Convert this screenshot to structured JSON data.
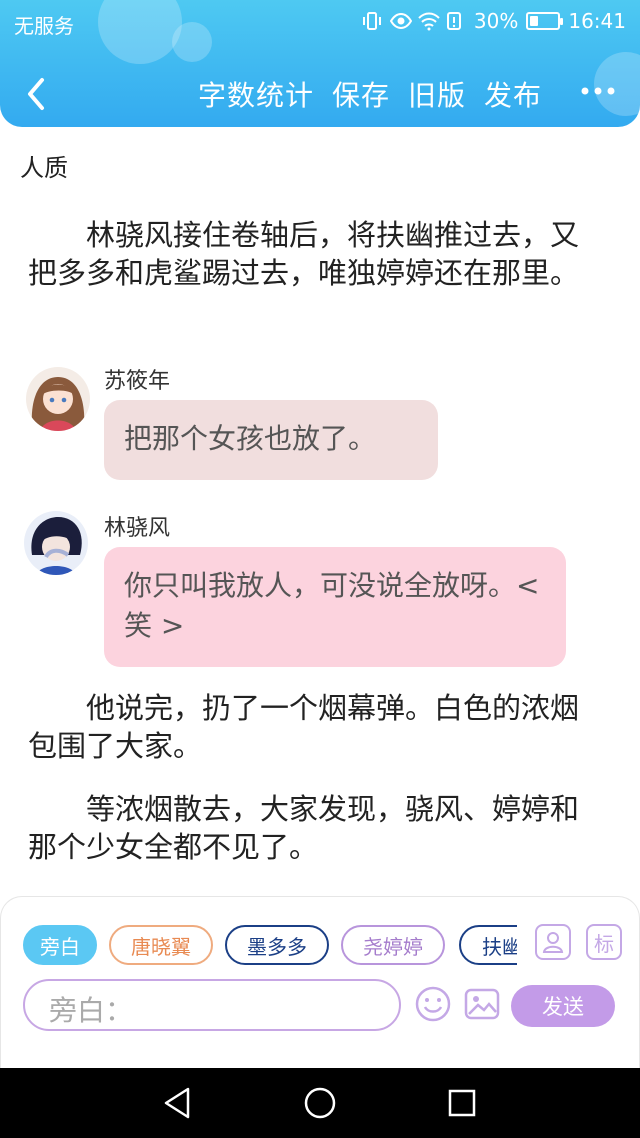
{
  "status_bar": {
    "carrier": "无服务",
    "battery_percent": "30%",
    "battery_level": 0.3,
    "time": "16:41"
  },
  "toolbar": {
    "actions": [
      "字数统计",
      "保存",
      "旧版",
      "发布"
    ]
  },
  "chapter_title": "人质",
  "paragraphs": [
    "林骁风接住卷轴后，将扶幽推过去，又把多多和虎鲨踢过去，唯独婷婷还在那里。",
    "他说完，扔了一个烟幕弹。白色的浓烟包围了大家。",
    "等浓烟散去，大家发现，骁风、婷婷和那个少女全都不见了。"
  ],
  "dialogues": [
    {
      "speaker": "苏筱年",
      "text": "把那个女孩也放了。",
      "bubble_color": "#f1dede"
    },
    {
      "speaker": "林骁风",
      "text": "你只叫我放人，可没说全放呀。< 笑 >",
      "bubble_color": "#fcd3de"
    }
  ],
  "roles": [
    {
      "label": "旁白",
      "color": "#ffffff",
      "bg": "#5bc8f3",
      "border": "#5bc8f3"
    },
    {
      "label": "唐晓翼",
      "color": "#e88a52",
      "bg": "#ffffff",
      "border": "#efab7f"
    },
    {
      "label": "墨多多",
      "color": "#1b3f86",
      "bg": "#ffffff",
      "border": "#1b3f86"
    },
    {
      "label": "尧婷婷",
      "color": "#a57ccc",
      "bg": "#ffffff",
      "border": "#b895dc"
    },
    {
      "label": "扶幽",
      "color": "#1b3f86",
      "bg": "#ffffff",
      "border": "#1b3f86"
    }
  ],
  "side_buttons": {
    "tag_label": "标"
  },
  "composer": {
    "placeholder": "旁白：",
    "send_label": "发送"
  },
  "colors": {
    "header_top": "#4ec9f2",
    "header_bottom": "#33aaf0",
    "accent_purple": "#c39be8"
  }
}
